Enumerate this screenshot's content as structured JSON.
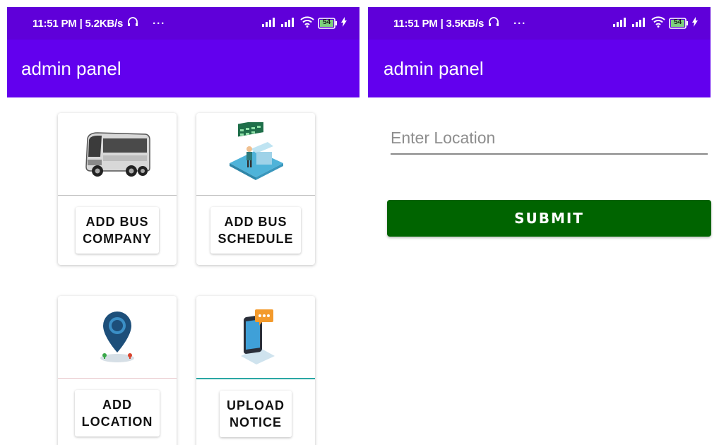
{
  "left_screen": {
    "status": {
      "time": "11:51 PM | 5.2KB/s",
      "dots": "···",
      "battery": "54"
    },
    "app_title": "admin panel",
    "cards": [
      {
        "line1": "ADD BUS",
        "line2": "COMPANY",
        "icon": "bus-icon"
      },
      {
        "line1": "ADD BUS",
        "line2": "SCHEDULE",
        "icon": "schedule-counter-icon"
      },
      {
        "line1": "ADD",
        "line2": "LOCATION",
        "icon": "location-pin-icon"
      },
      {
        "line1": "UPLOAD",
        "line2": "NOTICE",
        "icon": "phone-notice-icon"
      }
    ]
  },
  "right_screen": {
    "status": {
      "time": "11:51 PM | 3.5KB/s",
      "dots": "···",
      "battery": "54"
    },
    "app_title": "admin panel",
    "location_placeholder": "Enter Location",
    "submit_label": "SUBMIT"
  },
  "colors": {
    "status_bar": "#5f00d9",
    "app_bar": "#6200ee",
    "submit": "#006400"
  }
}
